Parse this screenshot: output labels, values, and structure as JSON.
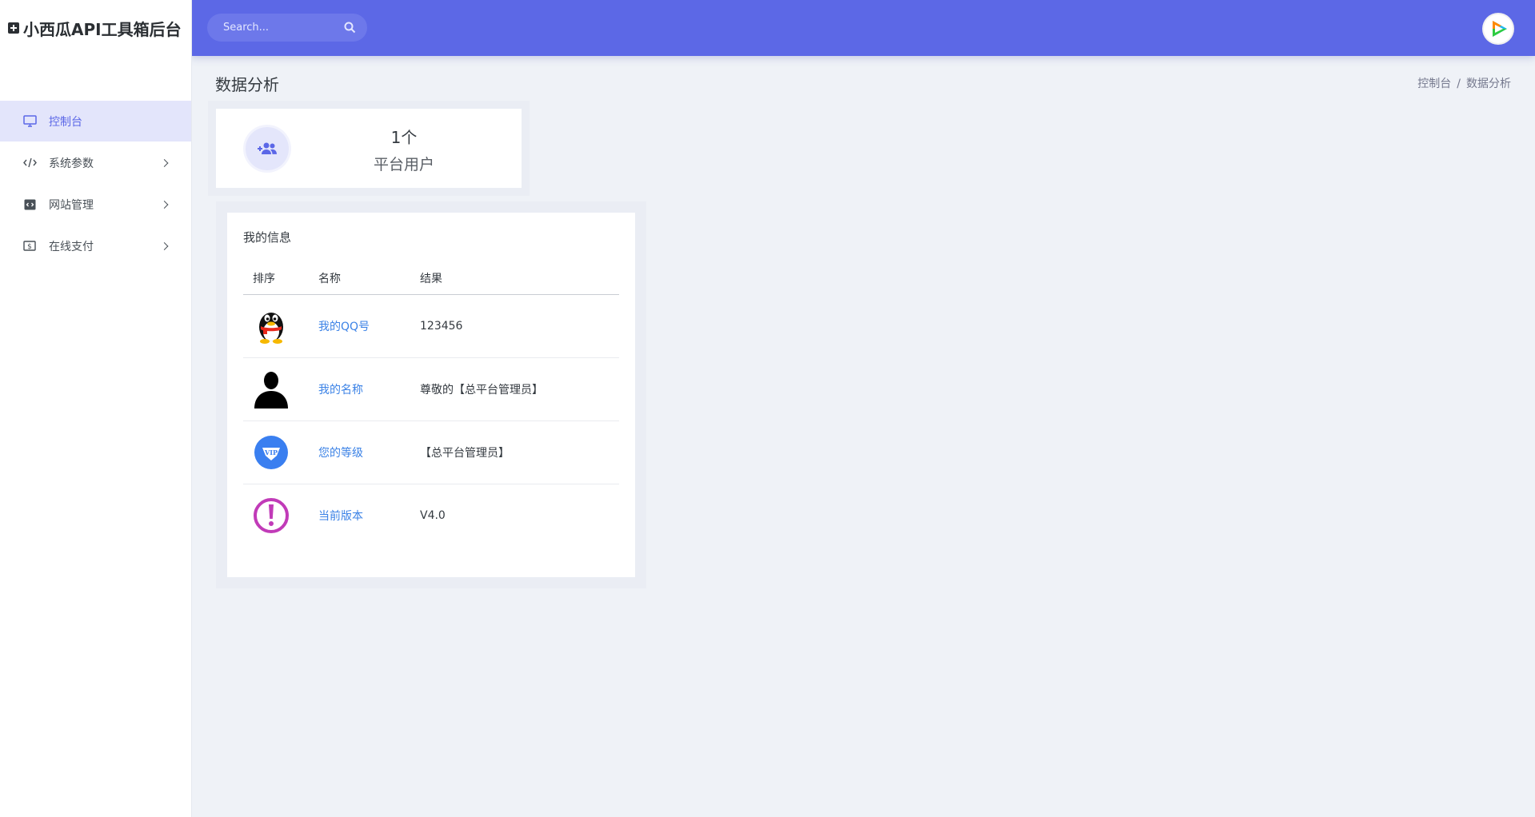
{
  "app": {
    "title": "小西瓜API工具箱后台"
  },
  "sidebar": {
    "items": [
      {
        "label": "控制台",
        "icon": "monitor-icon",
        "active": true
      },
      {
        "label": "系统参数",
        "icon": "code-icon"
      },
      {
        "label": "网站管理",
        "icon": "window-code-icon"
      },
      {
        "label": "在线支付",
        "icon": "dollar-bill-icon"
      }
    ]
  },
  "topbar": {
    "search": {
      "placeholder": "Search..."
    }
  },
  "page": {
    "title": "数据分析",
    "breadcrumb": [
      "控制台",
      "/",
      "数据分析"
    ]
  },
  "stat": {
    "value": "1个",
    "label": "平台用户",
    "icon": "user-add-icon"
  },
  "info": {
    "title": "我的信息",
    "columns": [
      "排序",
      "名称",
      "结果"
    ],
    "rows": [
      {
        "icon": "qq-penguin-icon",
        "name": "我的QQ号",
        "value": "123456"
      },
      {
        "icon": "user-silhouette-icon",
        "name": "我的名称",
        "value": "尊敬的【总平台管理员】"
      },
      {
        "icon": "vip-badge-icon",
        "name": "您的等级",
        "value": "【总平台管理员】"
      },
      {
        "icon": "exclamation-icon",
        "name": "当前版本",
        "value": "V4.0"
      }
    ]
  },
  "colors": {
    "primary": "#5c68e6",
    "active_bg": "#e3e5fb",
    "link": "#3b82e6",
    "background": "#eff2f7"
  }
}
